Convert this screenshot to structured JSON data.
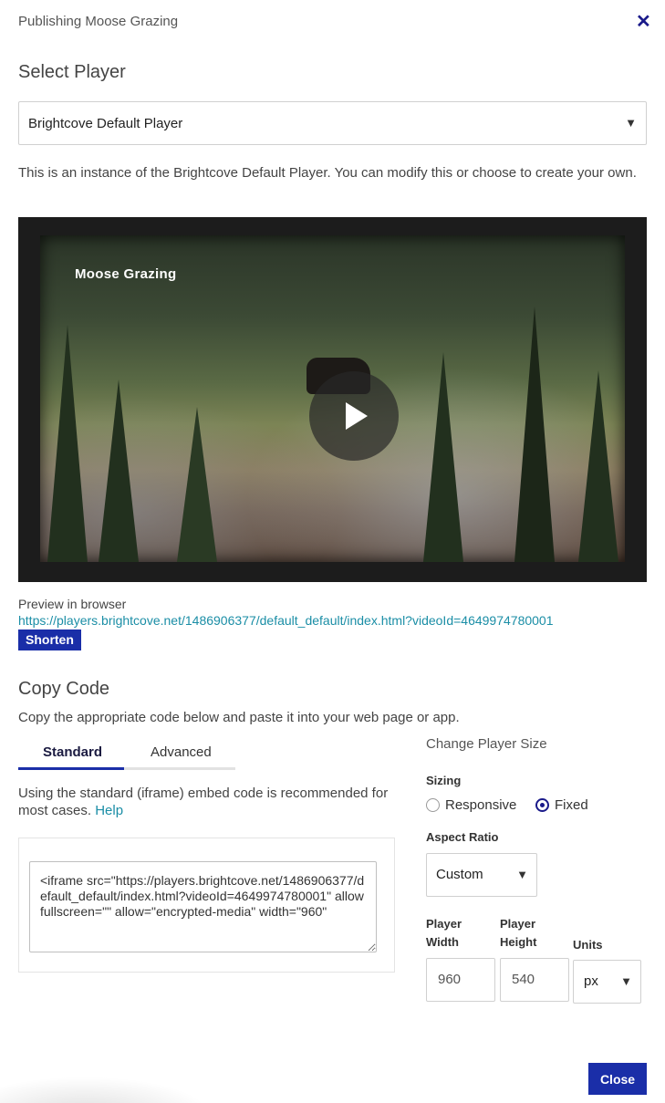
{
  "dialog": {
    "title": "Publishing Moose Grazing",
    "close_icon": "close-icon"
  },
  "select_player": {
    "heading": "Select Player",
    "selected": "Brightcove Default Player",
    "caret": "▼",
    "description": "This is an instance of the Brightcove Default Player. You can modify this or choose to create your own."
  },
  "video": {
    "title": "Moose Grazing",
    "play_icon": "play-icon"
  },
  "preview": {
    "label": "Preview in browser",
    "url": "https://players.brightcove.net/1486906377/default_default/index.html?videoId=4649974780001",
    "shorten_label": "Shorten"
  },
  "copy_code": {
    "heading": "Copy Code",
    "description": "Copy the appropriate code below and paste it into your web page or app.",
    "tabs": [
      {
        "label": "Standard",
        "active": true
      },
      {
        "label": "Advanced",
        "active": false
      }
    ],
    "standard_desc": "Using the standard (iframe) embed code is recommended for most cases.",
    "help_link": "Help",
    "code": "<iframe src=\"https://players.brightcove.net/1486906377/default_default/index.html?videoId=4649974780001\" allowfullscreen=\"\" allow=\"encrypted-media\" width=\"960\""
  },
  "player_size": {
    "heading": "Change Player Size",
    "sizing_label": "Sizing",
    "sizing_options": [
      {
        "label": "Responsive",
        "checked": false
      },
      {
        "label": "Fixed",
        "checked": true
      }
    ],
    "aspect_label": "Aspect Ratio",
    "aspect_value": "Custom",
    "width_label": "Player Width",
    "height_label": "Player Height",
    "units_label": "Units",
    "width_value": "960",
    "height_value": "540",
    "units_value": "px",
    "caret": "▼"
  },
  "footer": {
    "close_label": "Close"
  }
}
